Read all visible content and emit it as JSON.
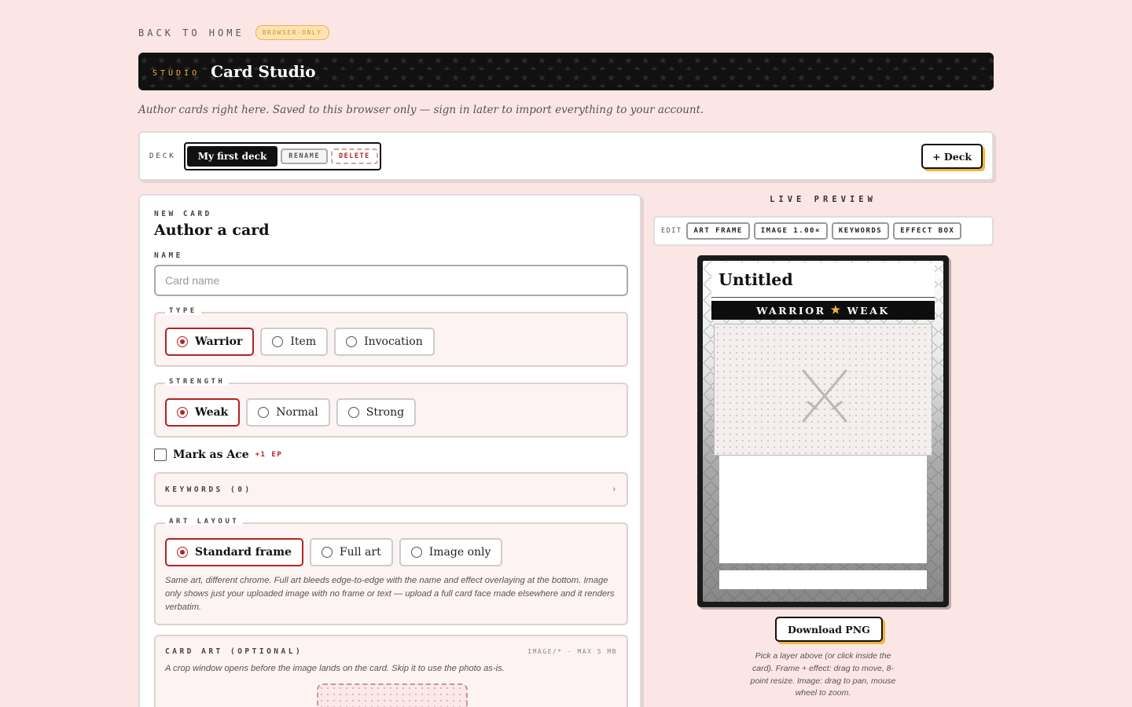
{
  "topbar": {
    "back_link": "BACK TO HOME",
    "badge": "BROWSER-ONLY"
  },
  "banner": {
    "tag": "STUDIO",
    "title": "Card Studio"
  },
  "subtitle": "Author cards right here. Saved to this browser only — sign in later to import everything to your account.",
  "deck": {
    "label": "DECK",
    "current": "My first deck",
    "rename": "RENAME",
    "delete": "DELETE",
    "add": "+ Deck"
  },
  "editor": {
    "eyebrow": "NEW CARD",
    "heading": "Author a card",
    "name_label": "NAME",
    "name_value": "",
    "name_placeholder": "Card name",
    "type": {
      "legend": "TYPE",
      "options": [
        "Warrior",
        "Item",
        "Invocation"
      ],
      "selected": "Warrior"
    },
    "strength": {
      "legend": "STRENGTH",
      "options": [
        "Weak",
        "Normal",
        "Strong"
      ],
      "selected": "Weak"
    },
    "ace": {
      "label": "Mark as Ace",
      "bonus": "+1 EP",
      "checked": false
    },
    "keywords": {
      "label": "KEYWORDS (0)",
      "chevron": "›"
    },
    "art_layout": {
      "legend": "ART LAYOUT",
      "options": [
        "Standard frame",
        "Full art",
        "Image only"
      ],
      "selected": "Standard frame",
      "help": "Same art, different chrome. Full art bleeds edge-to-edge with the name and effect overlaying at the bottom. Image only shows just your uploaded image with no frame or text — upload a full card face made elsewhere and it renders verbatim."
    },
    "card_art": {
      "label": "CARD ART (OPTIONAL)",
      "limit": "IMAGE/* · MAX 5 MB",
      "help": "A crop window opens before the image lands on the card. Skip it to use the photo as-is."
    }
  },
  "preview": {
    "label": "LIVE PREVIEW",
    "edit_label": "EDIT",
    "edit_chips": [
      "ART FRAME",
      "IMAGE 1.00×",
      "KEYWORDS",
      "EFFECT BOX"
    ],
    "card": {
      "name": "Untitled",
      "type_left": "WARRIOR",
      "type_star": "★",
      "type_right": "WEAK",
      "art_icon": "crossed-swords-icon"
    },
    "download": "Download PNG",
    "help": "Pick a layer above (or click inside the card). Frame + effect: drag to move, 8-point resize. Image: drag to pan, mouse wheel to zoom."
  },
  "colors": {
    "background": "#fbe6e5",
    "accent_red": "#b32424",
    "accent_gold": "#f2b53a",
    "ink": "#111111"
  }
}
